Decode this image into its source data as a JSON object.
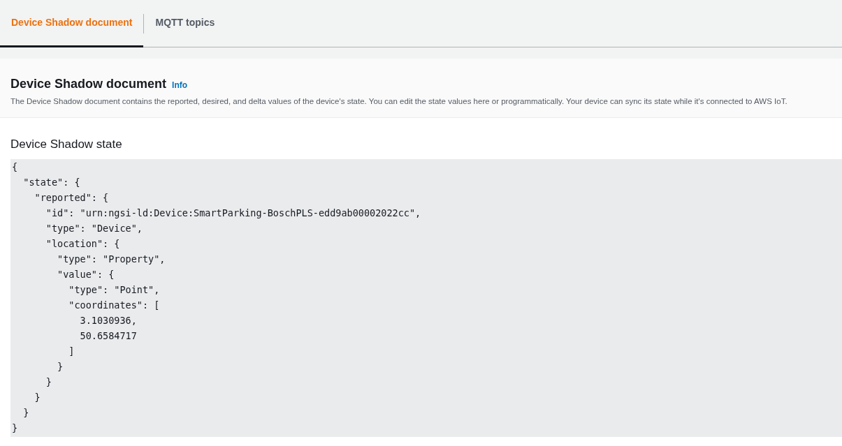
{
  "tabs": [
    {
      "label": "Device Shadow document",
      "selected": true
    },
    {
      "label": "MQTT topics",
      "selected": false
    }
  ],
  "header": {
    "title": "Device Shadow document",
    "info_link": "Info",
    "description": "The Device Shadow document contains the reported, desired, and delta values of the device's state. You can edit the state values here or programmatically. Your device can sync its state while it's connected to AWS IoT."
  },
  "shadow_state": {
    "title": "Device Shadow state",
    "code": "{\n  \"state\": {\n    \"reported\": {\n      \"id\": \"urn:ngsi-ld:Device:SmartParking-BoschPLS-edd9ab00002022cc\",\n      \"type\": \"Device\",\n      \"location\": {\n        \"type\": \"Property\",\n        \"value\": {\n          \"type\": \"Point\",\n          \"coordinates\": [\n            3.1030936,\n            50.6584717\n          ]\n        }\n      }\n    }\n  }\n}"
  }
}
